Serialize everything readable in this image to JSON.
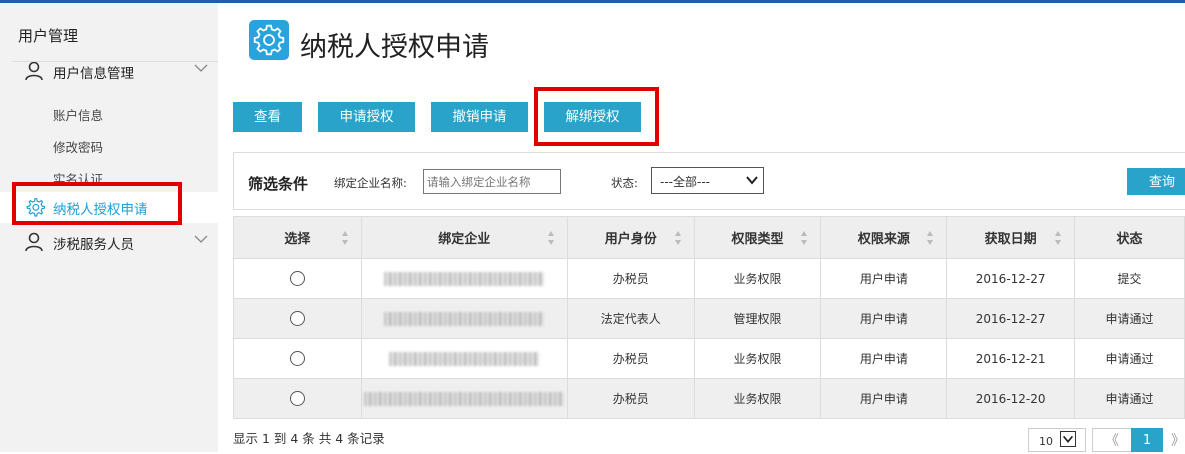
{
  "sidebar": {
    "title": "用户管理",
    "group1_label": "用户信息管理",
    "sub_items": [
      "账户信息",
      "修改密码",
      "实名认证"
    ],
    "active_item": "纳税人授权申请",
    "group2_label": "涉税服务人员"
  },
  "header": {
    "title": "纳税人授权申请"
  },
  "toolbar": {
    "view": "查看",
    "apply": "申请授权",
    "revoke": "撤销申请",
    "unbind": "解绑授权"
  },
  "filter": {
    "title": "筛选条件",
    "company_label": "绑定企业名称:",
    "company_placeholder": "请输入绑定企业名称",
    "status_label": "状态:",
    "status_value": "---全部---",
    "query_label": "查询"
  },
  "table": {
    "columns": [
      "选择",
      "绑定企业",
      "用户身份",
      "权限类型",
      "权限来源",
      "获取日期",
      "状态"
    ],
    "rows": [
      {
        "identity": "办税员",
        "perm_type": "业务权限",
        "source": "用户申请",
        "date": "2016-12-27",
        "status": "提交"
      },
      {
        "identity": "法定代表人",
        "perm_type": "管理权限",
        "source": "用户申请",
        "date": "2016-12-27",
        "status": "申请通过"
      },
      {
        "identity": "办税员",
        "perm_type": "业务权限",
        "source": "用户申请",
        "date": "2016-12-21",
        "status": "申请通过"
      },
      {
        "identity": "办税员",
        "perm_type": "业务权限",
        "source": "用户申请",
        "date": "2016-12-20",
        "status": "申请通过"
      }
    ]
  },
  "pagination": {
    "summary": "显示 1 到 4 条 共 4 条记录",
    "page_size": "10",
    "prev": "《",
    "current": "1",
    "next": "》"
  },
  "colors": {
    "accent": "#29a3c9",
    "highlight_box": "#e00000",
    "active_text": "#1e9fd6"
  }
}
